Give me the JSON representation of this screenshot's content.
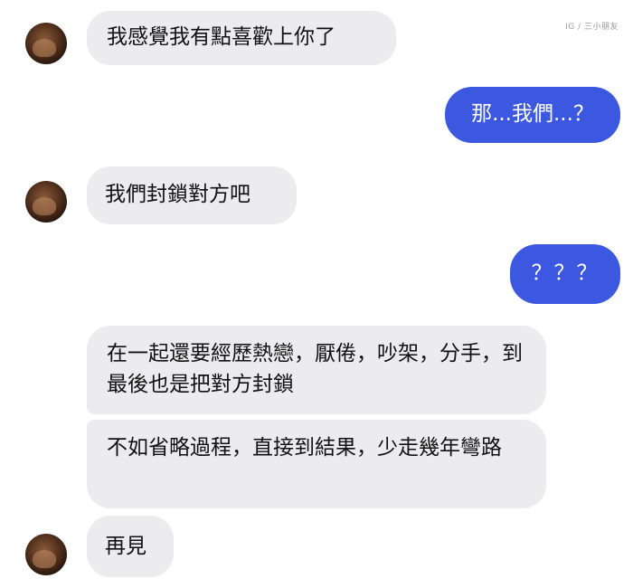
{
  "watermark": "IG / 三小朋友",
  "messages": [
    {
      "from": "them",
      "text": "我感覺我有點喜歡上你了"
    },
    {
      "from": "me",
      "text": "那...我們...？"
    },
    {
      "from": "them",
      "text": "我們封鎖對方吧"
    },
    {
      "from": "me",
      "text": "？？？"
    },
    {
      "from": "them",
      "text": "在一起還要經歷熱戀，厭倦，吵架，分手，到最後也是把對方封鎖"
    },
    {
      "from": "them",
      "text": "不如省略過程，直接到結果，少走幾年彎路"
    },
    {
      "from": "them",
      "text": "再見"
    }
  ],
  "colors": {
    "incoming_bubble": "#ececee",
    "outgoing_bubble": "#3c58e0"
  }
}
